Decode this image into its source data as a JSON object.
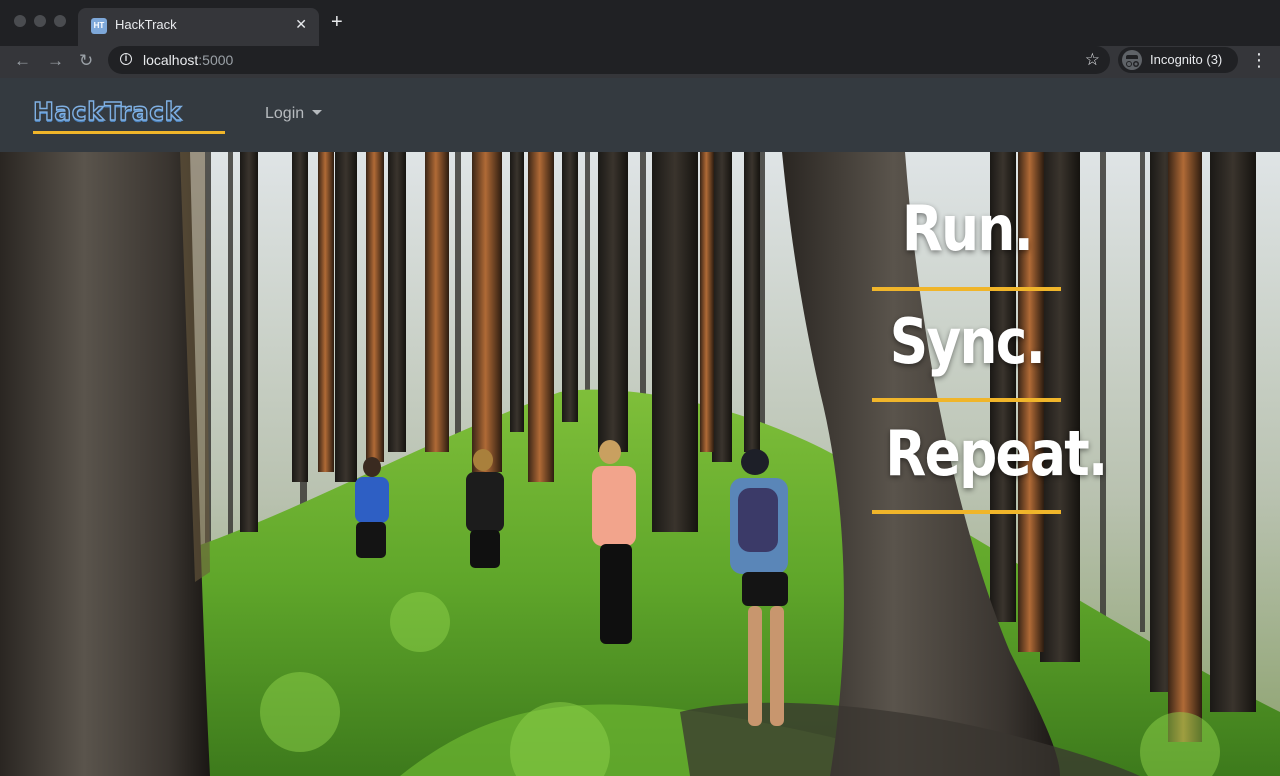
{
  "browser": {
    "tab_title": "HackTrack",
    "tab_favicon": "HT",
    "url_host": "localhost",
    "url_port": ":5000",
    "profile_label": "Incognito (3)"
  },
  "navbar": {
    "brand": "HackTrack",
    "login_label": "Login"
  },
  "hero": {
    "lines": [
      "Run.",
      "Sync.",
      "Repeat."
    ]
  },
  "colors": {
    "navbar_bg": "#343a40",
    "accent": "#f0b52a",
    "brand_blue": "#7fb0e3"
  }
}
